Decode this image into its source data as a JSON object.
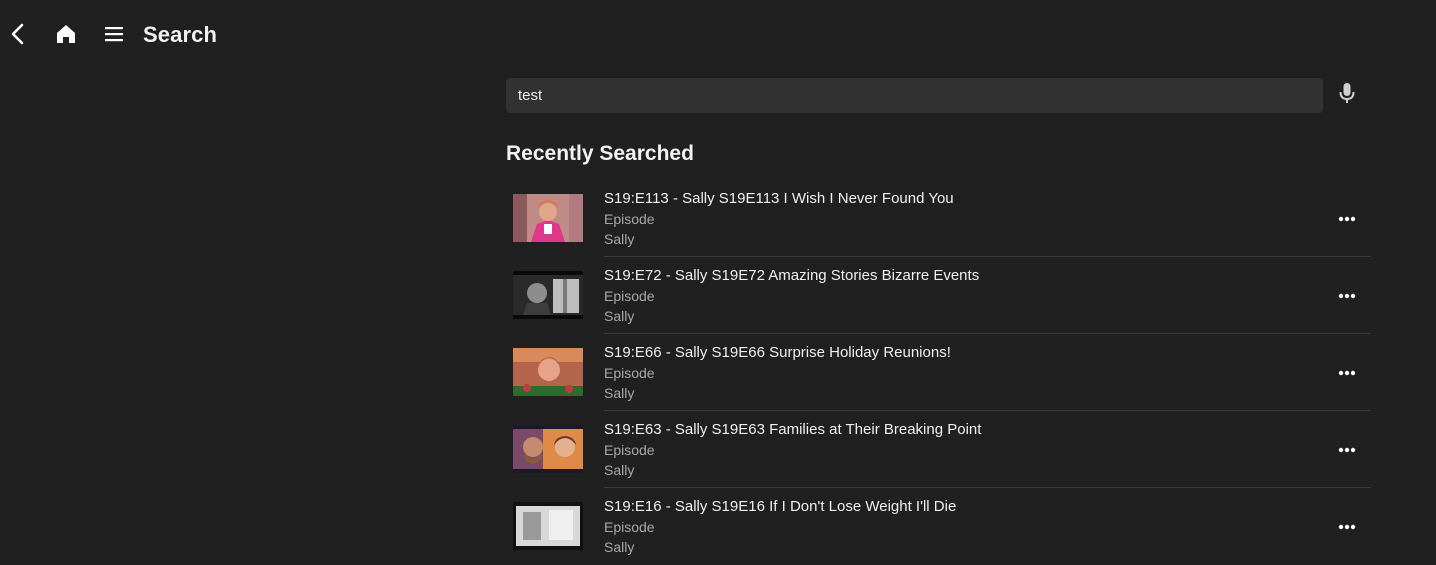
{
  "header": {
    "title": "Search",
    "back_icon": "chevron-left-icon",
    "home_icon": "home-icon",
    "menu_icon": "hamburger-menu-icon"
  },
  "search": {
    "value": "test",
    "placeholder": "",
    "mic_icon": "microphone-icon"
  },
  "recent": {
    "heading": "Recently Searched",
    "items": [
      {
        "title": "S19:E113 - Sally S19E113 I Wish I Never Found You",
        "type": "Episode",
        "show": "Sally"
      },
      {
        "title": "S19:E72 - Sally S19E72 Amazing Stories Bizarre Events",
        "type": "Episode",
        "show": "Sally"
      },
      {
        "title": "S19:E66 - Sally S19E66 Surprise Holiday Reunions!",
        "type": "Episode",
        "show": "Sally"
      },
      {
        "title": "S19:E63 - Sally S19E63 Families at Their Breaking Point",
        "type": "Episode",
        "show": "Sally"
      },
      {
        "title": "S19:E16 - Sally S19E16 If I Don't Lose Weight I'll Die",
        "type": "Episode",
        "show": "Sally"
      }
    ]
  },
  "colors": {
    "background": "#202020",
    "search_field": "#323232",
    "text_primary": "#f0f0f0",
    "text_secondary": "#a8a8a8",
    "divider": "#3a3a3a"
  }
}
